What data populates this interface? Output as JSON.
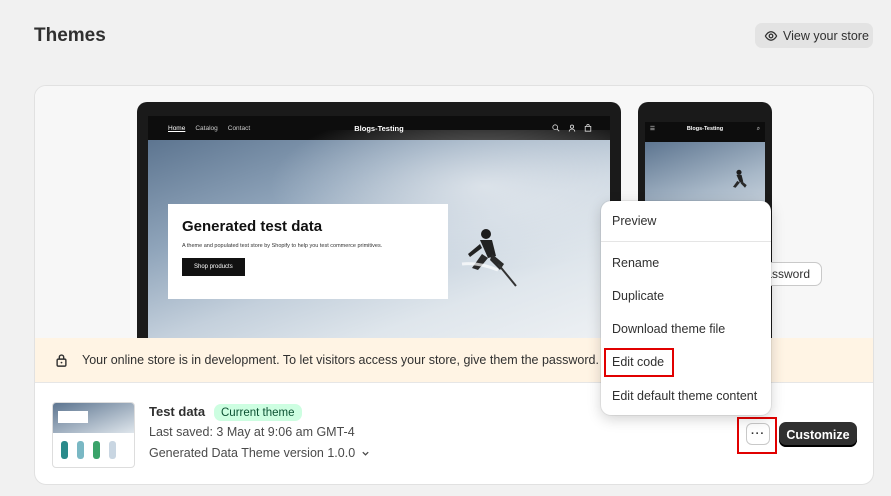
{
  "header": {
    "title": "Themes",
    "view_store_label": "View your store"
  },
  "preview": {
    "nav_links": [
      "Home",
      "Catalog",
      "Contact"
    ],
    "store_name": "Blogs-Testing",
    "hero_title": "Generated test data",
    "hero_subtitle": "A theme and populated test store by Shopify to help you test commerce primitives.",
    "hero_button": "Shop products"
  },
  "banner": {
    "message": "Your online store is in development. To let visitors access your store, give them the password.",
    "password_button": "store password"
  },
  "theme": {
    "name": "Test data",
    "badge": "Current theme",
    "last_saved": "Last saved: 3 May at 9:06 am GMT-4",
    "version": "Generated Data Theme version 1.0.0",
    "more_label": "···",
    "customize_label": "Customize"
  },
  "menu": {
    "items": [
      "Preview",
      "Rename",
      "Duplicate",
      "Download theme file",
      "Edit code",
      "Edit default theme content"
    ]
  },
  "colors": {
    "banner_bg": "#fff4e4",
    "badge_bg": "#cdfee1",
    "highlight": "#e10000",
    "primary_button": "#303030"
  }
}
